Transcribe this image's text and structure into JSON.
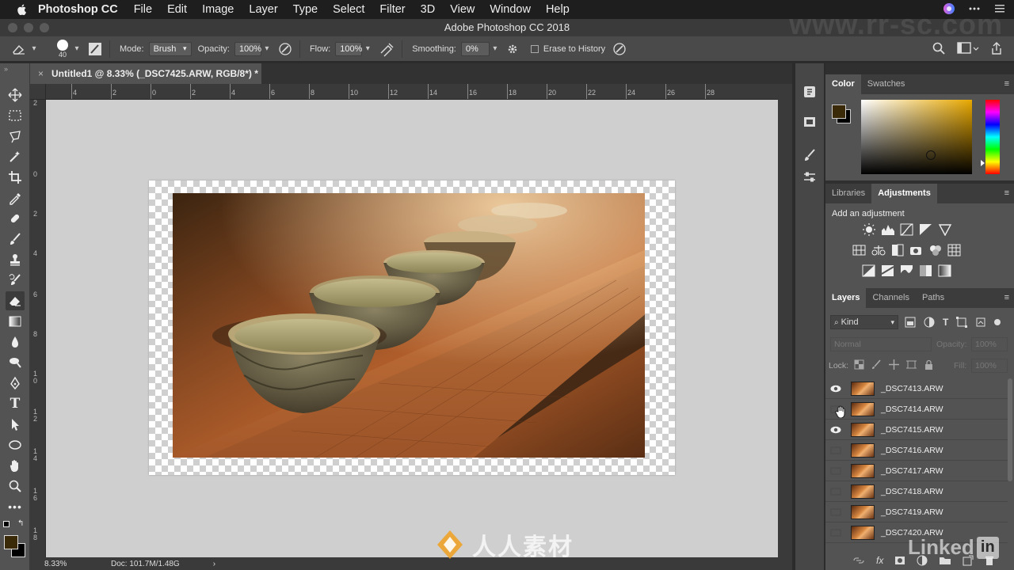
{
  "menubar": {
    "app_name": "Photoshop CC",
    "items": [
      "File",
      "Edit",
      "Image",
      "Layer",
      "Type",
      "Select",
      "Filter",
      "3D",
      "View",
      "Window",
      "Help"
    ]
  },
  "window": {
    "title": "Adobe Photoshop CC 2018"
  },
  "options_bar": {
    "brush_size": "40",
    "mode_label": "Mode:",
    "mode_value": "Brush",
    "opacity_label": "Opacity:",
    "opacity_value": "100%",
    "flow_label": "Flow:",
    "flow_value": "100%",
    "smoothing_label": "Smoothing:",
    "smoothing_value": "0%",
    "erase_history_label": "Erase to History"
  },
  "document_tab": {
    "close": "×",
    "title": "Untitled1 @ 8.33% (_DSC7425.ARW, RGB/8*) *"
  },
  "rulers": {
    "horizontal": [
      "4",
      "2",
      "0",
      "2",
      "4",
      "6",
      "8",
      "10",
      "12",
      "14",
      "16",
      "18",
      "20",
      "22",
      "24",
      "26",
      "28"
    ],
    "vertical": [
      "2",
      "0",
      "2",
      "4",
      "6",
      "8",
      "1\n0",
      "1\n2",
      "1\n4",
      "1\n6",
      "1\n8"
    ]
  },
  "status": {
    "zoom": "8.33%",
    "doc_info": "Doc: 101.7M/1.48G",
    "arrow": "›"
  },
  "color_panel": {
    "tabs": [
      "Color",
      "Swatches"
    ],
    "foreground": "#3a2a08",
    "background": "#000000",
    "hue_color": "#e8a800"
  },
  "adjustments_panel": {
    "tabs": [
      "Libraries",
      "Adjustments"
    ],
    "heading": "Add an adjustment"
  },
  "layers_panel": {
    "tabs": [
      "Layers",
      "Channels",
      "Paths"
    ],
    "filter_label": "Kind",
    "blend_mode": "Normal",
    "opacity_label": "Opacity:",
    "opacity_value": "100%",
    "lock_label": "Lock:",
    "fill_label": "Fill:",
    "fill_value": "100%",
    "layers": [
      {
        "name": "_DSC7413.ARW",
        "visible": true
      },
      {
        "name": "_DSC7414.ARW",
        "visible": false
      },
      {
        "name": "_DSC7415.ARW",
        "visible": true
      },
      {
        "name": "_DSC7416.ARW",
        "visible": false
      },
      {
        "name": "_DSC7417.ARW",
        "visible": false
      },
      {
        "name": "_DSC7418.ARW",
        "visible": false
      },
      {
        "name": "_DSC7419.ARW",
        "visible": false
      },
      {
        "name": "_DSC7420.ARW",
        "visible": false
      }
    ],
    "footer_fx": "fx"
  },
  "watermarks": {
    "site": "www.rr-sc.com",
    "brand": "人人素材",
    "linkedin": "Linked"
  }
}
